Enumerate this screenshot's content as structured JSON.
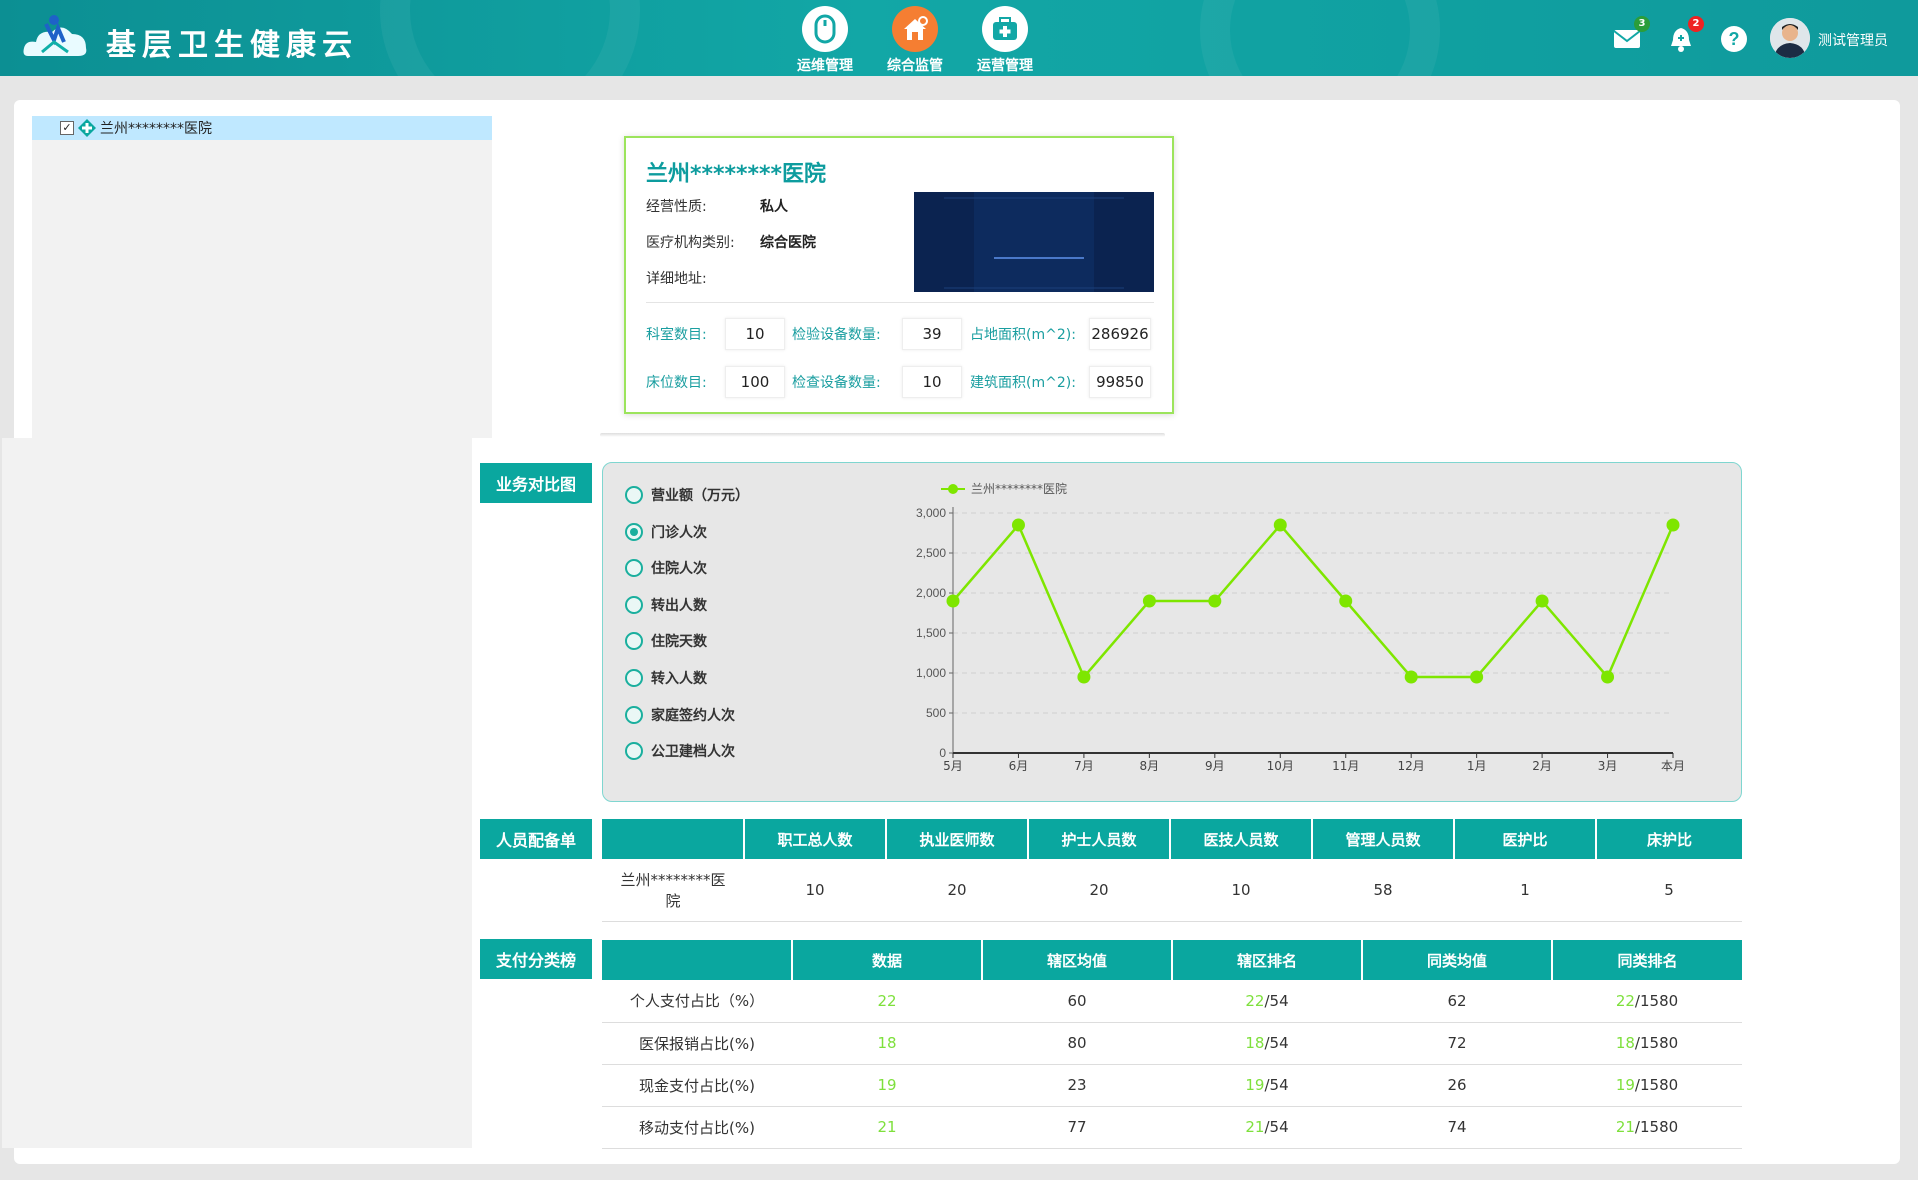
{
  "header": {
    "title": "基层卫生健康云",
    "nav": [
      {
        "label": "运维管理",
        "icon": "mouse-icon",
        "active": false
      },
      {
        "label": "综合监管",
        "icon": "home-settings-icon",
        "active": true
      },
      {
        "label": "运营管理",
        "icon": "medical-kit-icon",
        "active": false
      }
    ],
    "mail_badge": "3",
    "bell_badge": "2",
    "user_name": "测试管理员",
    "accent": "#0f9a9c"
  },
  "tree": {
    "node_label": "兰州********医院",
    "checked": true
  },
  "hospital": {
    "name": "兰州********医院",
    "fields": [
      {
        "label": "经营性质:",
        "value": "私人"
      },
      {
        "label": "医疗机构类别:",
        "value": "综合医院"
      },
      {
        "label": "详细地址:",
        "value": ""
      }
    ],
    "stats": [
      {
        "label": "科室数目:",
        "value": "10"
      },
      {
        "label": "检验设备数量:",
        "value": "39"
      },
      {
        "label": "占地面积(m^2):",
        "value": "286926"
      },
      {
        "label": "床位数目:",
        "value": "100"
      },
      {
        "label": "检查设备数量:",
        "value": "10"
      },
      {
        "label": "建筑面积(m^2):",
        "value": "99850"
      }
    ]
  },
  "sections": {
    "business": "业务对比图",
    "staff": "人员配备单",
    "payment": "支付分类榜"
  },
  "radios": [
    {
      "label": "营业额（万元）",
      "selected": false
    },
    {
      "label": "门诊人次",
      "selected": true
    },
    {
      "label": "住院人次",
      "selected": false
    },
    {
      "label": "转出人数",
      "selected": false
    },
    {
      "label": "住院天数",
      "selected": false
    },
    {
      "label": "转入人数",
      "selected": false
    },
    {
      "label": "家庭签约人次",
      "selected": false
    },
    {
      "label": "公卫建档人次",
      "selected": false
    }
  ],
  "chart_data": {
    "type": "line",
    "categories": [
      "5月",
      "6月",
      "7月",
      "8月",
      "9月",
      "10月",
      "11月",
      "12月",
      "1月",
      "2月",
      "3月",
      "本月"
    ],
    "series": [
      {
        "name": "兰州********医院",
        "values": [
          1900,
          2850,
          950,
          1900,
          1900,
          2850,
          1900,
          950,
          950,
          1900,
          950,
          2850
        ],
        "color": "#7ee600"
      }
    ],
    "ylim": [
      0,
      3000
    ],
    "yticks": [
      "0",
      "500",
      "1,000",
      "1,500",
      "2,000",
      "2,500",
      "3,000"
    ],
    "grid": true,
    "legend": "top"
  },
  "staff_table": {
    "headers": [
      "",
      "职工总人数",
      "执业医师数",
      "护士人员数",
      "医技人员数",
      "管理人员数",
      "医护比",
      "床护比"
    ],
    "rows": [
      [
        "兰州********医院",
        "10",
        "20",
        "20",
        "10",
        "58",
        "1",
        "5"
      ]
    ]
  },
  "payment_table": {
    "headers": [
      "",
      "数据",
      "辖区均值",
      "辖区排名",
      "同类均值",
      "同类排名"
    ],
    "rows": [
      {
        "label": "个人支付占比（%）",
        "data": "22",
        "area_avg": "60",
        "area_rank": "22",
        "area_total": "/54",
        "peer_avg": "62",
        "peer_rank": "22",
        "peer_total": "/1580"
      },
      {
        "label": "医保报销占比(%)",
        "data": "18",
        "area_avg": "80",
        "area_rank": "18",
        "area_total": "/54",
        "peer_avg": "72",
        "peer_rank": "18",
        "peer_total": "/1580"
      },
      {
        "label": "现金支付占比(%)",
        "data": "19",
        "area_avg": "23",
        "area_rank": "19",
        "area_total": "/54",
        "peer_avg": "26",
        "peer_rank": "19",
        "peer_total": "/1580"
      },
      {
        "label": "移动支付占比(%)",
        "data": "21",
        "area_avg": "77",
        "area_rank": "21",
        "area_total": "/54",
        "peer_avg": "74",
        "peer_rank": "21",
        "peer_total": "/1580"
      }
    ]
  }
}
